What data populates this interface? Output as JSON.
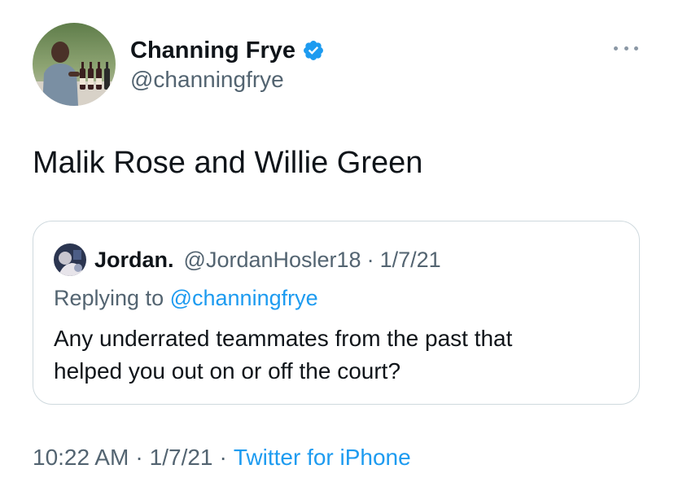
{
  "author": {
    "display_name": "Channing Frye",
    "handle": "@channingfrye",
    "verified": true,
    "avatar_icon": "profile-photo-with-wine-bottles",
    "verified_icon": "verified-badge-icon"
  },
  "tweet": {
    "text": "Malik Rose and Willie Green"
  },
  "quoted_tweet": {
    "display_name": "Jordan.",
    "handle": "@JordanHosler18",
    "separator": "·",
    "date": "1/7/21",
    "replying_prefix": "Replying to ",
    "replying_to": "@channingfrye",
    "text_line1": "Any underrated teammates from the past that",
    "text_line2": "helped you out on or off the court?"
  },
  "meta": {
    "time": "10:22 AM",
    "dot1": "·",
    "date": "1/7/21",
    "dot2": "·",
    "source": "Twitter for iPhone"
  },
  "colors": {
    "text": "#0f1419",
    "secondary": "#536471",
    "link": "#1d9bf0",
    "border": "#cfd9de"
  }
}
